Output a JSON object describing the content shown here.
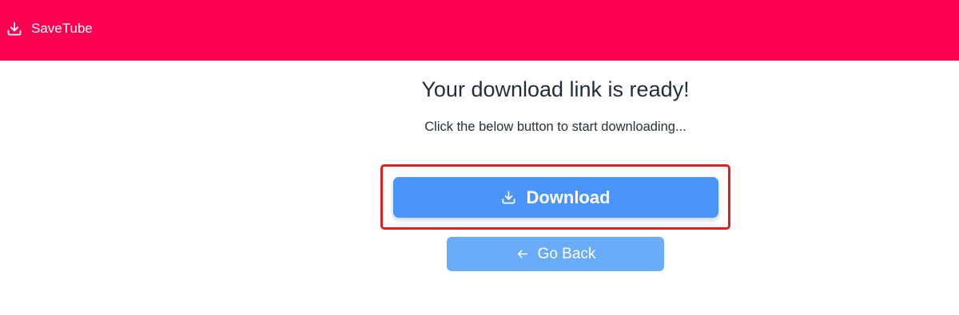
{
  "header": {
    "brand_name": "SaveTube",
    "brand_icon": "download-icon",
    "background_color": "#ff0050"
  },
  "main": {
    "title": "Your download link is ready!",
    "subtitle": "Click the below button to start downloading...",
    "download_button": {
      "label": "Download",
      "icon": "download-icon",
      "color": "#4a95f7"
    },
    "back_button": {
      "label": "Go Back",
      "icon": "arrow-left-icon",
      "color": "#6aabfa"
    },
    "highlight_color": "#e02020"
  }
}
